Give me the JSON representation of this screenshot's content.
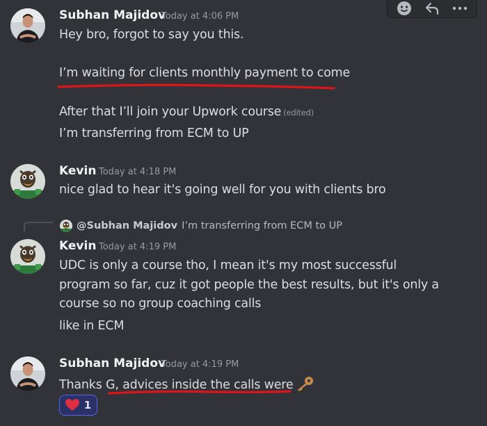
{
  "messages": [
    {
      "author": "Subhan Majidov",
      "timestamp": "Today at 4:06 PM",
      "lines": [
        "Hey bro, forgot to say you this.",
        "I’m waiting for clients monthly payment to come",
        "After that I’ll join your Upwork course",
        "I’m transferring from ECM to UP"
      ],
      "edited_label": "(edited)"
    },
    {
      "author": "Kevin",
      "timestamp": "Today at 4:18 PM",
      "lines": [
        "nice glad to hear it's going well for you with clients bro"
      ]
    },
    {
      "author": "Kevin",
      "timestamp": "Today at 4:19 PM",
      "reply": {
        "mention": "@Subhan Majidov",
        "text": "I’m transferring from ECM to UP"
      },
      "lines": [
        "UDC is only a course tho, I mean it's my most successful",
        "program so far, cuz it got people the best results, but it's only a",
        "course so no group coaching calls",
        "like in ECM"
      ]
    },
    {
      "author": "Subhan Majidov",
      "timestamp": "Today at 4:19 PM",
      "lines": [
        "Thanks G, advices inside the calls were"
      ],
      "reaction": {
        "emoji": "heart",
        "count": "1"
      }
    }
  ],
  "toolbar": {
    "icons": [
      "add-reaction-icon",
      "reply-icon",
      "more-icon"
    ]
  },
  "colors": {
    "background": "#313338",
    "annotation_red": "#e0121a",
    "reaction_border": "#5865f2"
  }
}
